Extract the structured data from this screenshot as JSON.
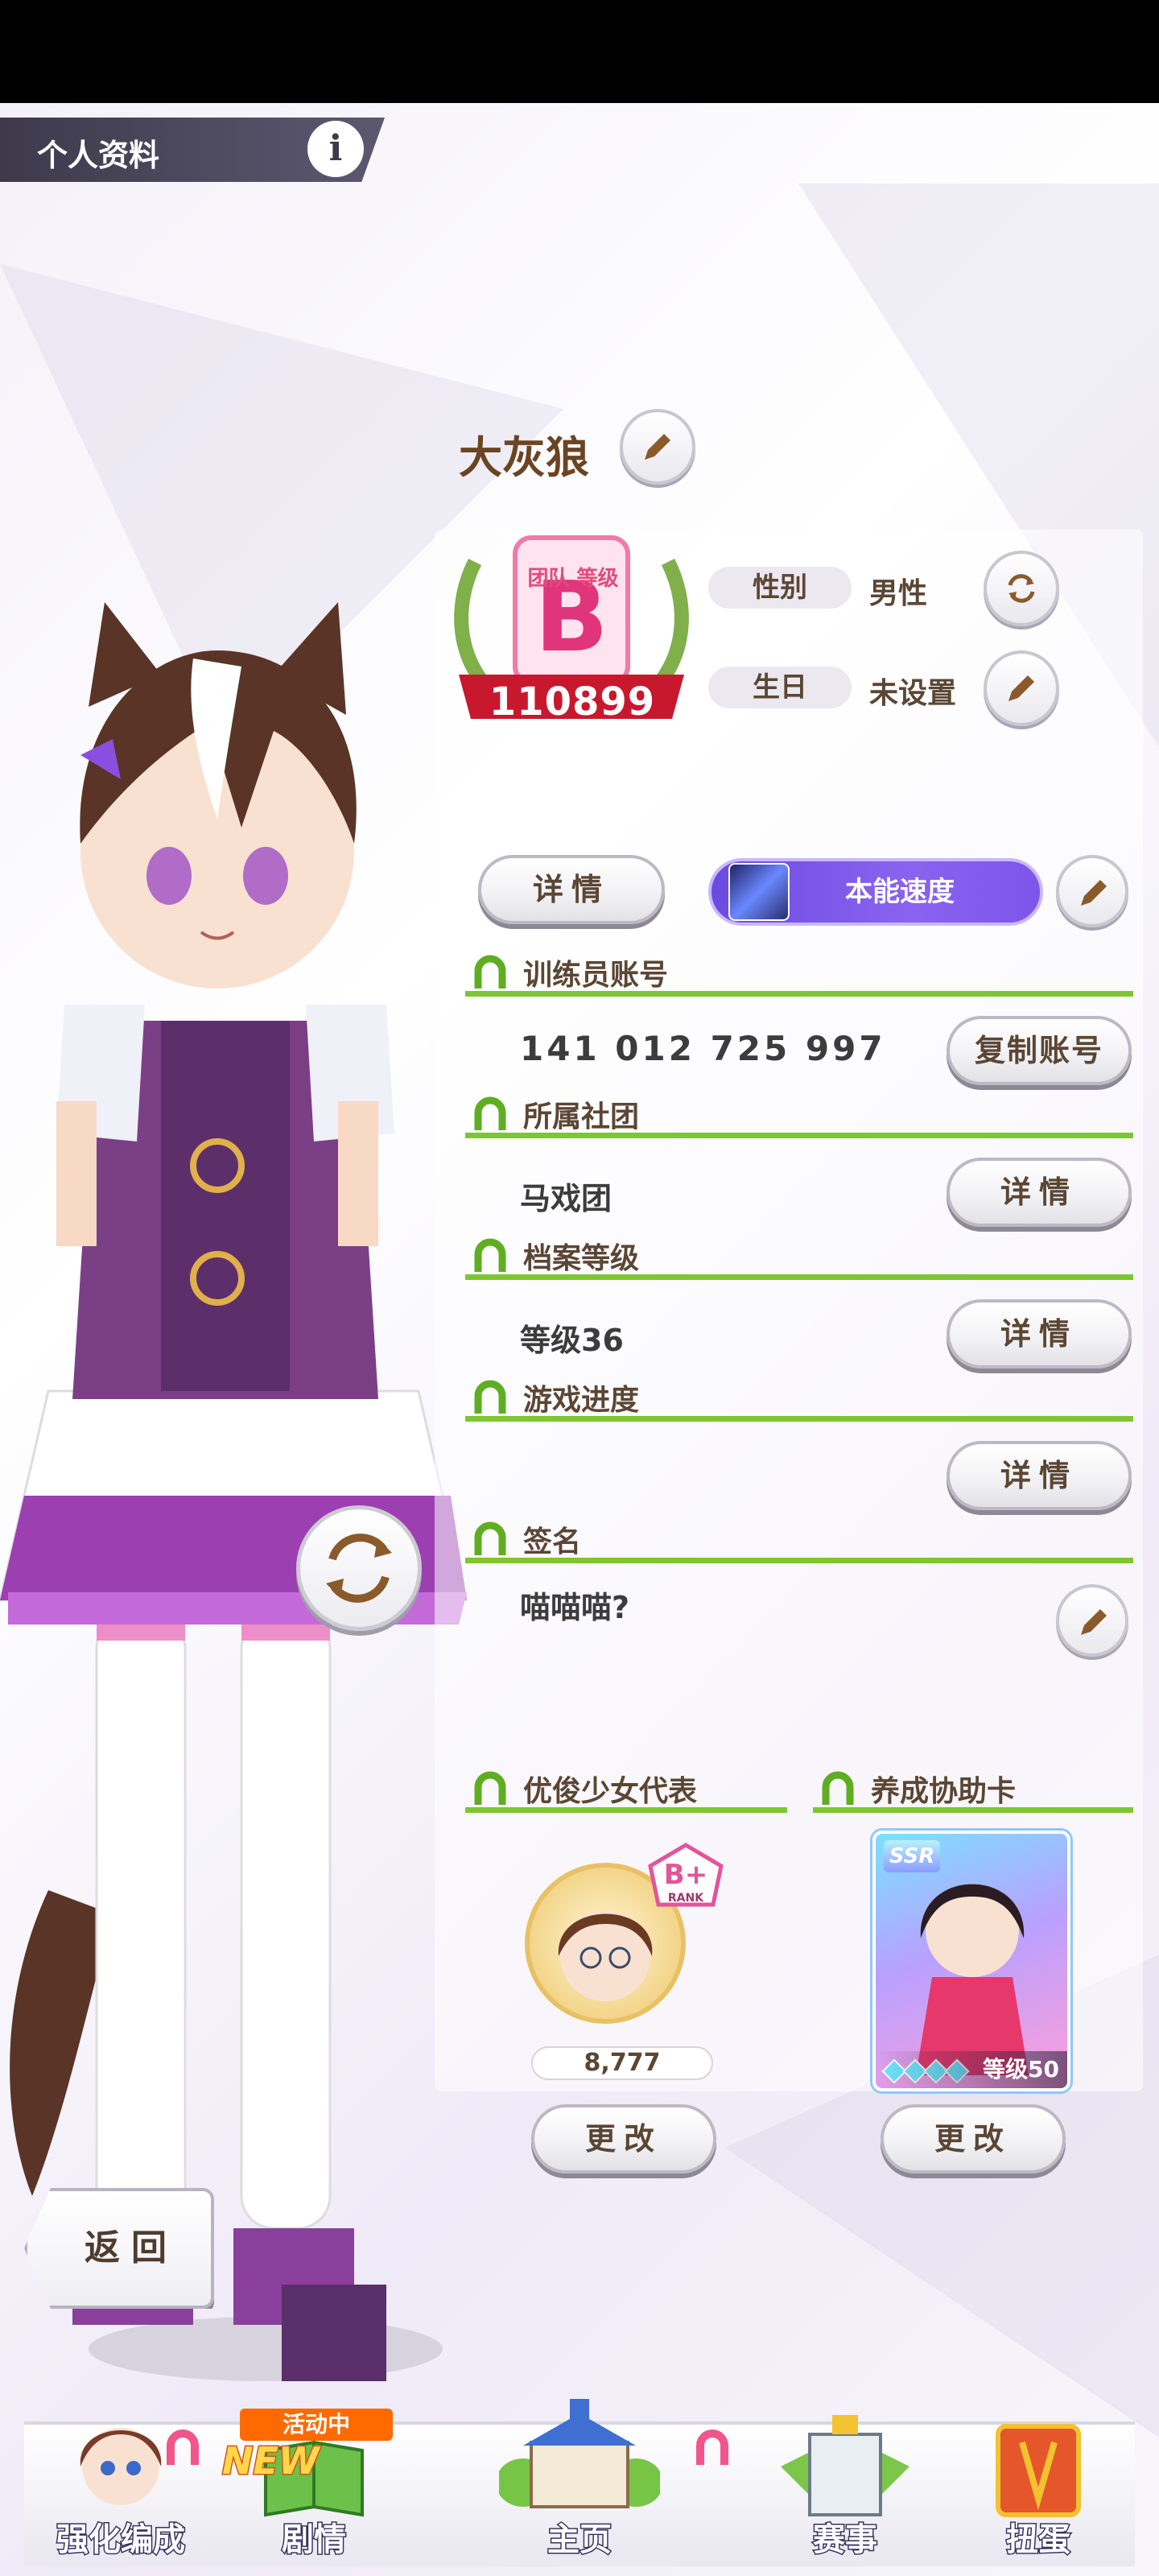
{
  "header": {
    "title": "个人资料",
    "info_glyph": "i"
  },
  "profile": {
    "name": "大灰狼",
    "team_rank": {
      "caption": "团队 等级",
      "grade": "B",
      "score": "110899"
    },
    "gender": {
      "label": "性别",
      "value": "男性"
    },
    "birthday": {
      "label": "生日",
      "value": "未设置"
    },
    "detail_label": "详情",
    "skill_label": "本能速度"
  },
  "sections": {
    "account": {
      "title": "训练员账号",
      "value": "141 012 725 997",
      "button": "复制账号"
    },
    "club": {
      "title": "所属社团",
      "value": "马戏团",
      "button": "详情"
    },
    "archive": {
      "title": "档案等级",
      "value": "等级36",
      "button": "详情"
    },
    "progress": {
      "title": "游戏进度",
      "button": "详情"
    },
    "signature": {
      "title": "签名",
      "value": "喵喵喵?"
    }
  },
  "representative": {
    "title": "优俊少女代表",
    "rank": "B+",
    "rank_caption": "RANK",
    "score": "8,777",
    "button": "更改"
  },
  "support_card": {
    "title": "养成协助卡",
    "rarity": "SSR",
    "level": "等级50",
    "button": "更改"
  },
  "back_button": "返回",
  "nav": {
    "items": [
      {
        "label": "强化编成",
        "icon": "character-icon"
      },
      {
        "label": "剧情",
        "icon": "story-book-icon",
        "tag": "活动中",
        "new": "NEW"
      },
      {
        "label": "主页",
        "icon": "home-building-icon"
      },
      {
        "label": "赛事",
        "icon": "race-gate-icon"
      },
      {
        "label": "扭蛋",
        "icon": "gacha-icon"
      }
    ]
  },
  "colors": {
    "accent_green": "#7dc631",
    "brown_text": "#5b4634",
    "skill_purple": "#7a55ea",
    "header_dark": "#3e3a4c"
  }
}
